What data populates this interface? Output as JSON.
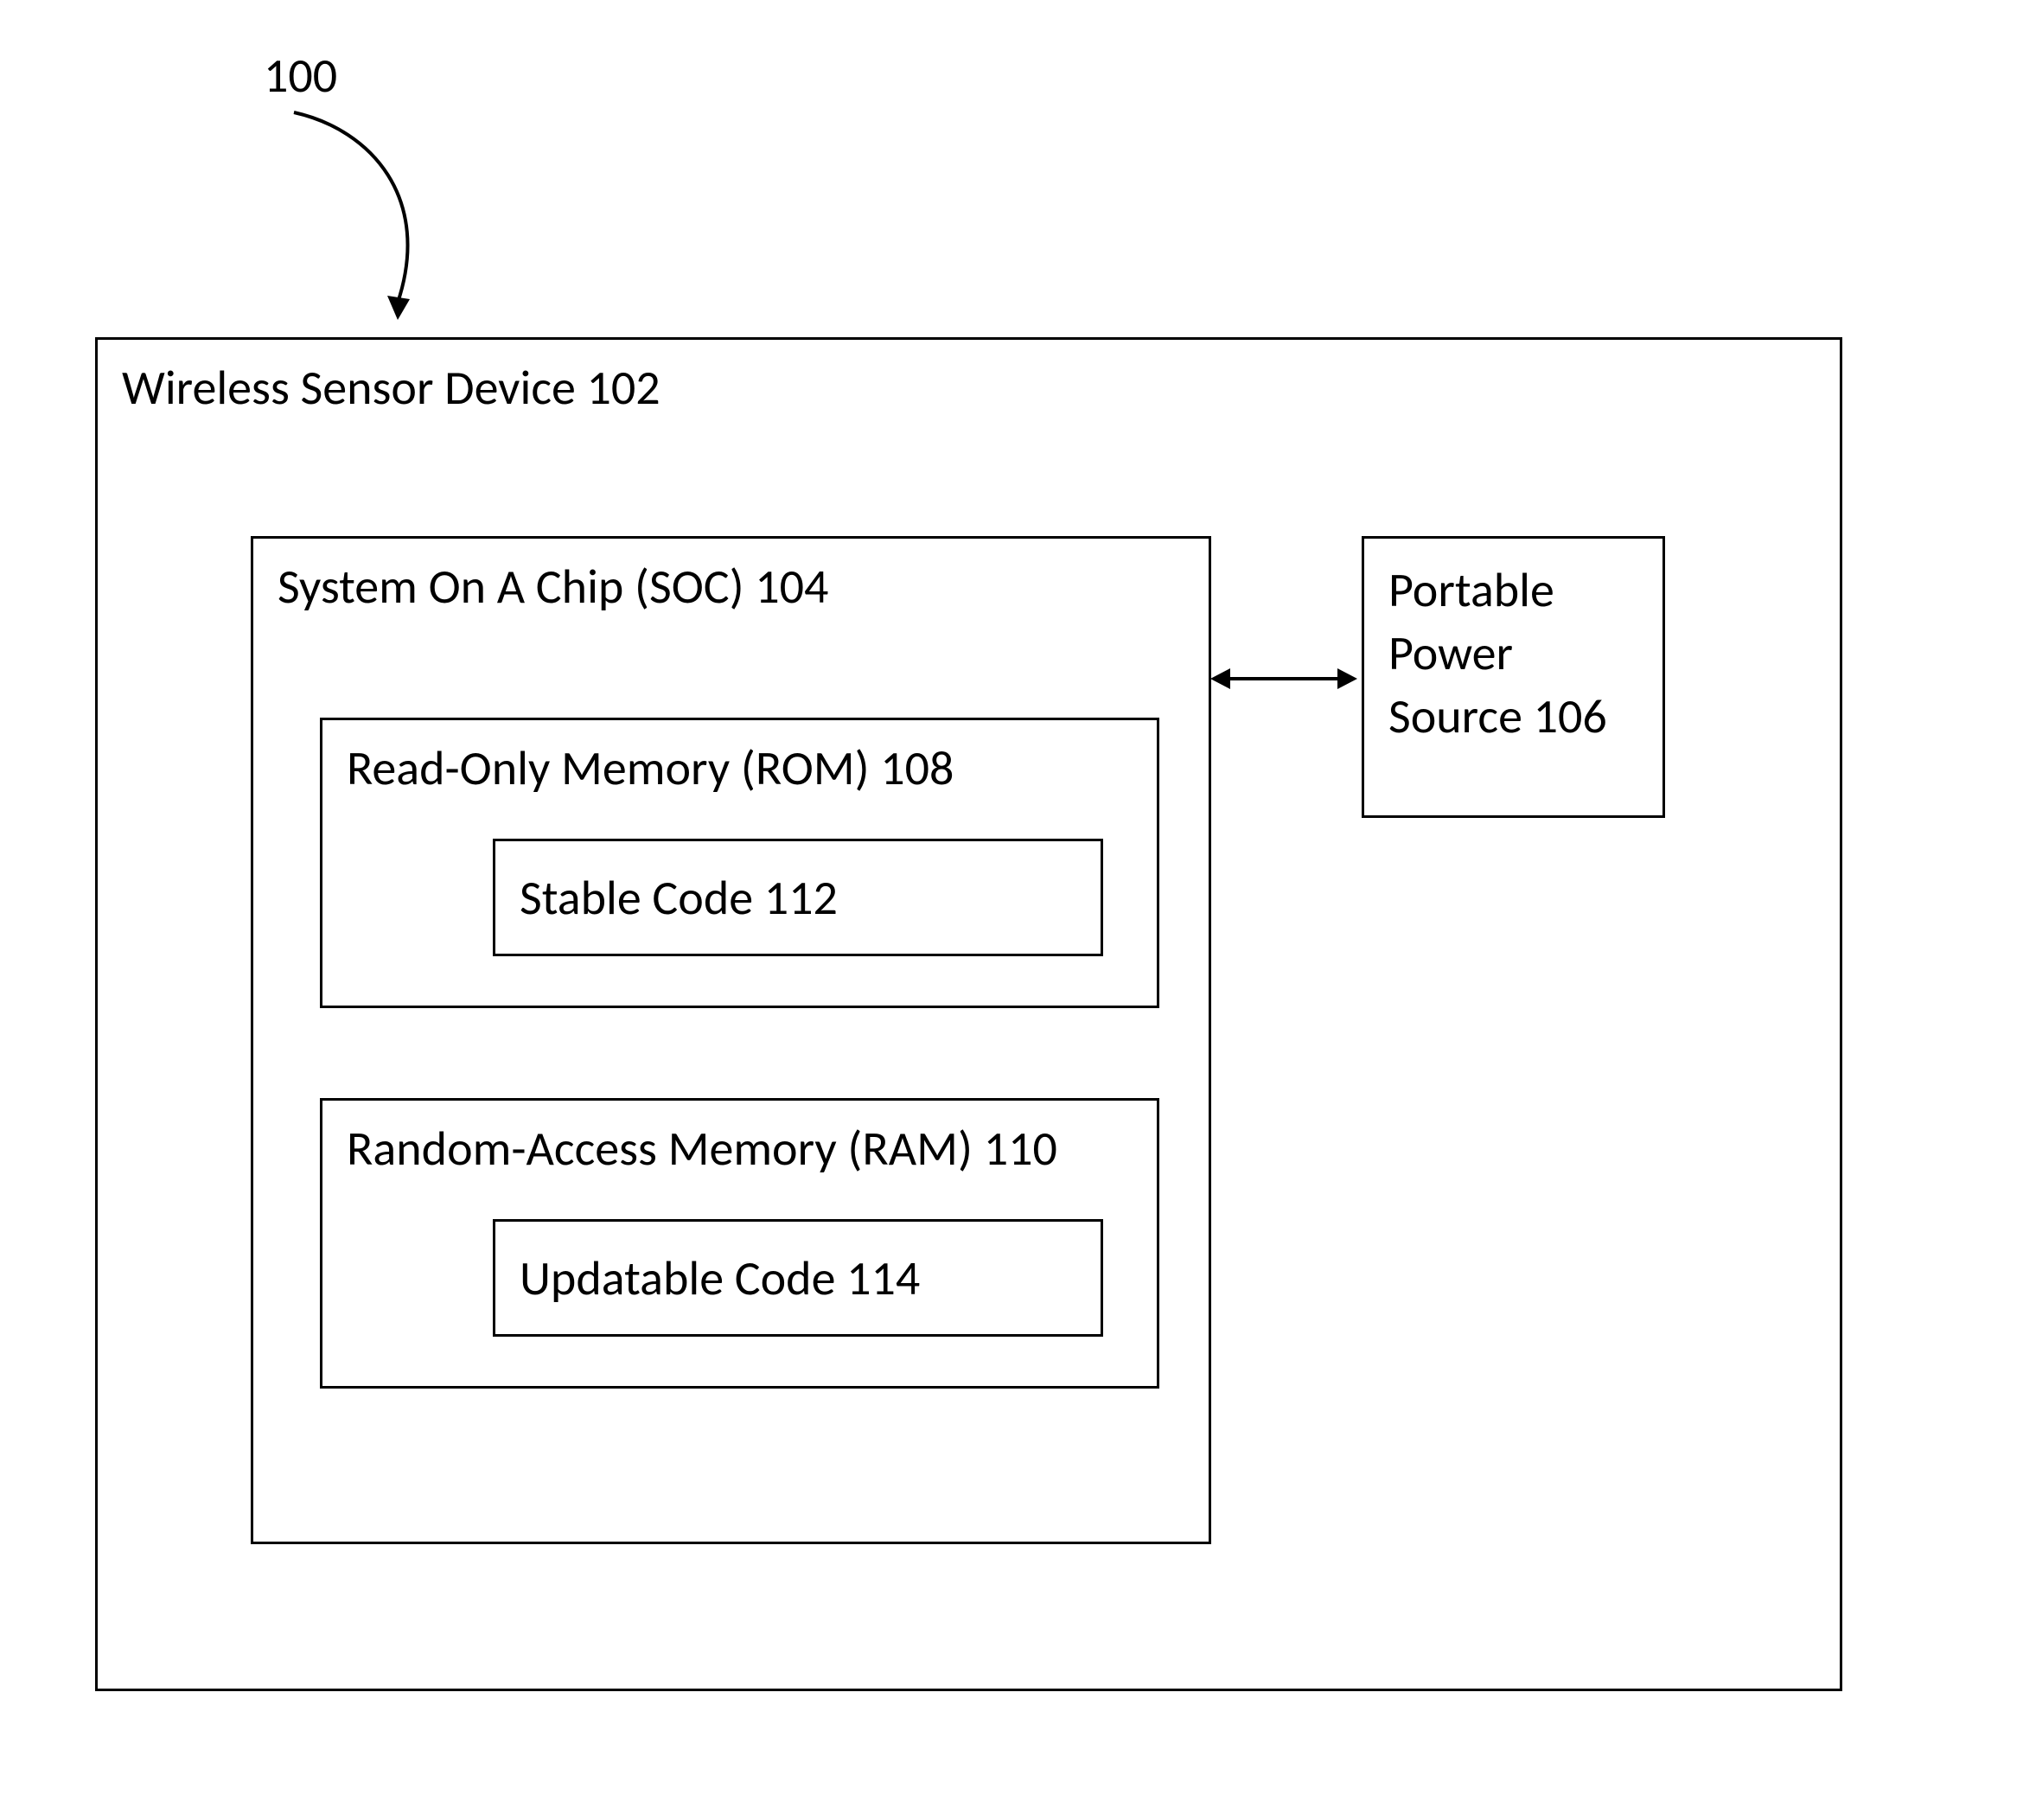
{
  "figure_number": "100",
  "wireless_sensor_device": {
    "label": "Wireless Sensor Device 102"
  },
  "soc": {
    "label": "System On A Chip (SOC) 104"
  },
  "rom": {
    "label": "Read-Only Memory (ROM) 108"
  },
  "stable_code": {
    "label": "Stable Code 112"
  },
  "ram": {
    "label": "Random-Access Memory (RAM) 110"
  },
  "updatable_code": {
    "label": "Updatable Code 114"
  },
  "power_source": {
    "line1": "Portable",
    "line2": "Power",
    "line3": "Source 106"
  }
}
